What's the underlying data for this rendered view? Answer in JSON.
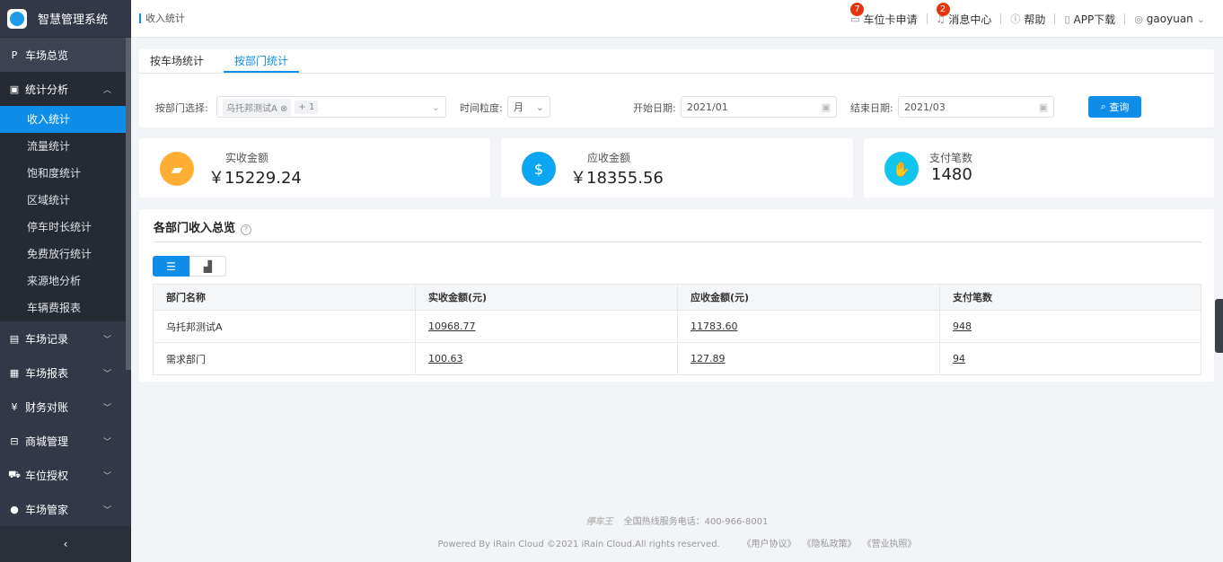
{
  "app": {
    "title": "智慧管理系统"
  },
  "sidebar": {
    "items": [
      {
        "label": "车场总览",
        "icon": "parking-icon"
      },
      {
        "label": "统计分析",
        "icon": "monitor-chart-icon",
        "children": [
          "收入统计",
          "流量统计",
          "饱和度统计",
          "区域统计",
          "停车时长统计",
          "免费放行统计",
          "来源地分析",
          "车辆费报表"
        ],
        "active_child": "收入统计"
      },
      {
        "label": "车场记录",
        "icon": "record-icon"
      },
      {
        "label": "车场报表",
        "icon": "report-icon"
      },
      {
        "label": "财务对账",
        "icon": "yen-icon"
      },
      {
        "label": "商城管理",
        "icon": "shop-icon"
      },
      {
        "label": "车位授权",
        "icon": "car-icon"
      },
      {
        "label": "车场管家",
        "icon": "user-icon"
      }
    ]
  },
  "header": {
    "breadcrumb": "收入统计",
    "items": [
      {
        "label": "车位卡申请",
        "badge": "7"
      },
      {
        "label": "消息中心",
        "badge": "2"
      },
      {
        "label": "帮助"
      },
      {
        "label": "APP下载"
      },
      {
        "label": "gaoyuan"
      }
    ]
  },
  "tabs": [
    "按车场统计",
    "按部门统计"
  ],
  "filters": {
    "dept_label": "按部门选择:",
    "dept_tag": "乌托邦测试A",
    "dept_more": "+ 1",
    "granularity_label": "时间粒度:",
    "granularity": "月",
    "start_label": "开始日期:",
    "start": "2021/01",
    "end_label": "结束日期:",
    "end": "2021/03",
    "query": "查询"
  },
  "stats": [
    {
      "title": "实收金额",
      "value": "￥15229.24",
      "color": "#ffae34"
    },
    {
      "title": "应收金额",
      "value": "￥18355.56",
      "color": "#0ba5f1"
    },
    {
      "title": "支付笔数",
      "value": "1480",
      "color": "#11c6ec"
    }
  ],
  "section": {
    "title": "各部门收入总览"
  },
  "table": {
    "headers": [
      "部门名称",
      "实收金额(元)",
      "应收金额(元)",
      "支付笔数"
    ],
    "rows": [
      [
        "乌托邦测试A",
        "10968.77",
        "11783.60",
        "948"
      ],
      [
        "需求部门",
        "100.63",
        "127.89",
        "94"
      ]
    ]
  },
  "footer": {
    "brand": "停车王",
    "hotline": "全国热线服务电话：400-966-8001",
    "copyright": "Powered By iRain Cloud ©2021 iRain Cloud.All rights reserved.",
    "links": [
      "《用户协议》",
      "《隐私政策》",
      "《营业执照》"
    ]
  }
}
